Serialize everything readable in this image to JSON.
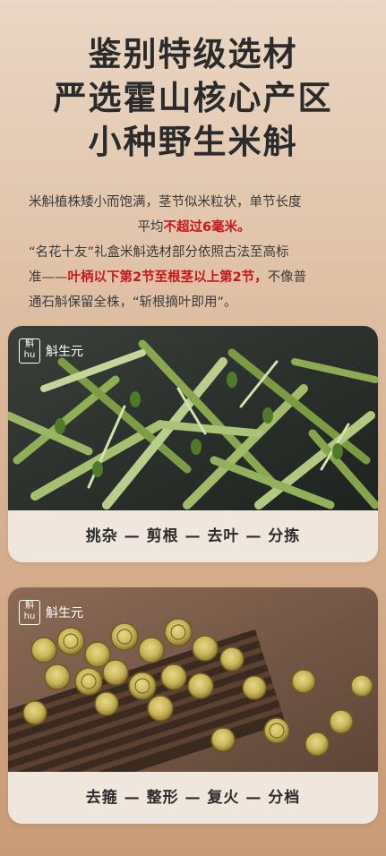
{
  "title": {
    "line1": "鉴别特级选材",
    "line2": "严选霍山核心产区",
    "line3": "小种野生米斛"
  },
  "description": {
    "p1_a": "米斛植株矮小而饱满，茎节似米粒状，单节长度",
    "p1_b": "平均",
    "p1_red": "不超过6毫米。",
    "p2_a": "“名花十友”礼盒米斛选材部分依照古法至高标",
    "p2_b": "准——",
    "p2_red": "叶柄以下第2节至根茎以上第2节，",
    "p2_c": "不像普",
    "p2_d": "通石斛保留全株，“斩根摘叶即用”。"
  },
  "cards": [
    {
      "logo_text": "斛生元",
      "caption": "挑杂 — 剪根 — 去叶 — 分拣"
    },
    {
      "logo_text": "斛生元",
      "caption": "去箍 — 整形 — 复火 — 分档"
    }
  ],
  "colors": {
    "accent_red": "#c8161d",
    "card_bg": "#efe6de"
  }
}
